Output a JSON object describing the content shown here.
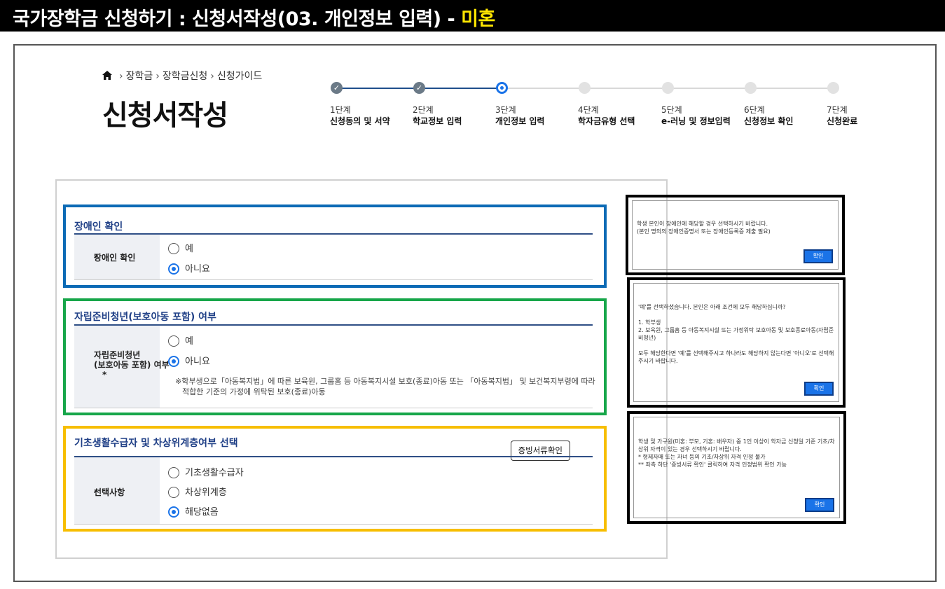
{
  "header": {
    "title_main": "국가장학금 신청하기 : 신청서작성(03. 개인정보 입력) - ",
    "title_accent": "미혼"
  },
  "breadcrumb": {
    "items": [
      "장학금",
      "장학금신청",
      "신청가이드"
    ]
  },
  "page_title": "신청서작성",
  "steps": [
    {
      "num": "1단계",
      "label": "신청동의 및 서약",
      "state": "done"
    },
    {
      "num": "2단계",
      "label": "학교정보 입력",
      "state": "done"
    },
    {
      "num": "3단계",
      "label": "개인정보 입력",
      "state": "current"
    },
    {
      "num": "4단계",
      "label": "학자금유형 선택",
      "state": "todo"
    },
    {
      "num": "5단계",
      "label": "e-러닝 및 정보입력",
      "state": "todo"
    },
    {
      "num": "6단계",
      "label": "신청정보 확인",
      "state": "todo"
    },
    {
      "num": "7단계",
      "label": "신청완료",
      "state": "todo"
    }
  ],
  "disability": {
    "title": "장애인 확인",
    "label": "장애인 확인",
    "required_mark": "*",
    "options": [
      "예",
      "아니요"
    ],
    "selected": "아니요"
  },
  "youth": {
    "title": "자립준비청년(보호아동 포함) 여부",
    "label_line1": "자립준비청년",
    "label_line2": "(보호아동 포함) 여부",
    "required_mark": "*",
    "options": [
      "예",
      "아니요"
    ],
    "selected": "아니요",
    "note_line1": "※학부생으로「아동복지법」에 따른 보육원, 그룹홈 등 아동복지시설 보호(종료)아동 또는 「아동복지법」 및 보건복지부령에 따라",
    "note_line2": "적합한 기준의 가정에 위탁된 보호(종료)아동"
  },
  "basic_living": {
    "title": "기초생활수급자 및 차상위계층여부 선택",
    "proof_button": "증빙서류확인",
    "label": "선택사항",
    "required_mark": "*",
    "options": [
      "기초생활수급자",
      "차상위계층",
      "해당없음"
    ],
    "selected": "해당없음"
  },
  "side_boxes": {
    "disability": {
      "text": "학생 본인이 장애인에 해당할 경우 선택하시기 바랍니다.\n(본인 명의의 장애인증명서 또는 장애인등록증 제출 필요)",
      "button": "확인"
    },
    "youth": {
      "text": "'예'를 선택하셨습니다. 본인은 아래 조건에 모두 해당하십니까?\n\n1. 학부생\n2. 보육원, 그룹홈 등 아동복지시설 또는 가정위탁 보호아동 및 보호종료아동(자립준비청년)\n\n모두 해당한다면 '예'를 선택해주시고 하나라도 해당하지 않는다면 '아니오'로 선택해주시기 바랍니다.",
      "button": "확인"
    },
    "basic_living": {
      "text": "학생 및 가구원(미혼: 부모, 기혼: 배우자) 중 1인 이상이 학자금 신청일 기준 기초/차상위 자격이 있는 경우 선택하시기 바랍니다.\n* 형제자매 또는 자녀 등의 기초/차상위 자격 인정 불가\n** 좌측 하단 '증빙서류 확인' 클릭하여 자격 인정범위 확인 가능",
      "button": "확인"
    }
  },
  "colors": {
    "highlight_blue": "#0c6ab5",
    "highlight_green": "#17a64a",
    "highlight_yellow": "#f7be00",
    "accent": "#1a73e8",
    "title_accent": "#ffe600"
  }
}
